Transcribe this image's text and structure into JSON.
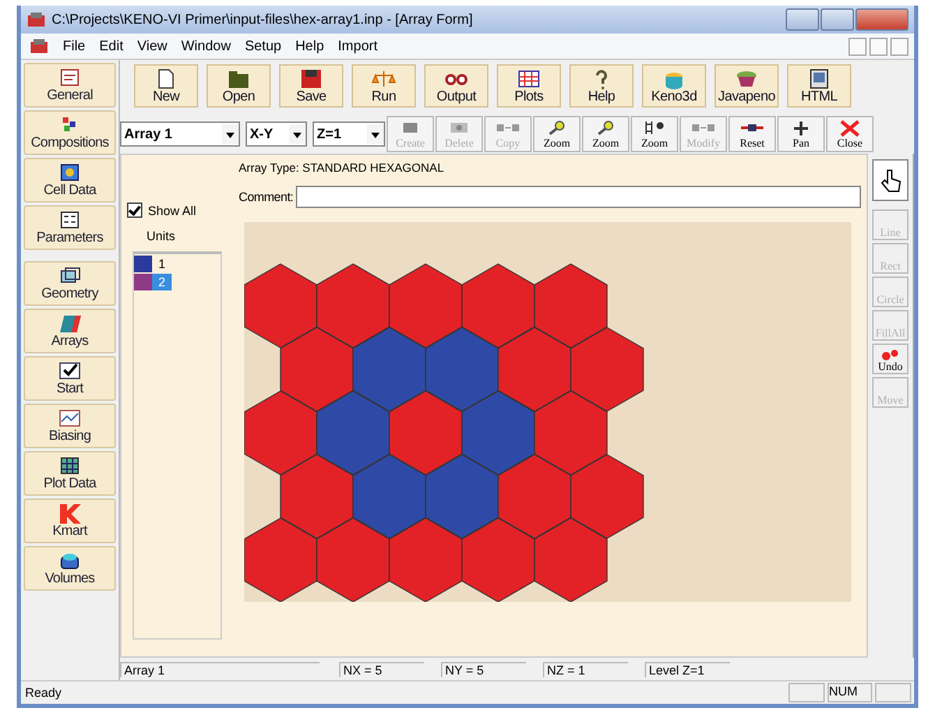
{
  "window": {
    "title": "C:\\Projects\\KENO-VI Primer\\input-files\\hex-array1.inp - [Array Form]"
  },
  "menu": [
    "File",
    "Edit",
    "View",
    "Window",
    "Setup",
    "Help",
    "Import"
  ],
  "toolbar": [
    {
      "label": "New"
    },
    {
      "label": "Open"
    },
    {
      "label": "Save"
    },
    {
      "label": "Run"
    },
    {
      "label": "Output"
    },
    {
      "label": "Plots"
    },
    {
      "label": "Help"
    },
    {
      "label": "Keno3d"
    },
    {
      "label": "Javapeno"
    },
    {
      "label": "HTML"
    }
  ],
  "sidebar": [
    {
      "label": "General"
    },
    {
      "label": "Compositions"
    },
    {
      "label": "Cell Data"
    },
    {
      "label": "Parameters"
    },
    {
      "label": "Geometry"
    },
    {
      "label": "Arrays"
    },
    {
      "label": "Start"
    },
    {
      "label": "Biasing"
    },
    {
      "label": "Plot Data"
    },
    {
      "label": "Kmart"
    },
    {
      "label": "Volumes"
    }
  ],
  "array_toolbar": {
    "dropdowns": [
      "Array 1",
      "X-Y",
      "Z=1"
    ],
    "buttons": [
      {
        "label": "Create",
        "disabled": true
      },
      {
        "label": "Delete",
        "disabled": true
      },
      {
        "label": "Copy",
        "disabled": true
      },
      {
        "label": "Zoom",
        "disabled": false
      },
      {
        "label": "Zoom",
        "disabled": false
      },
      {
        "label": "Zoom",
        "disabled": false
      },
      {
        "label": "Modify",
        "disabled": true
      },
      {
        "label": "Reset",
        "disabled": false
      },
      {
        "label": "Pan",
        "disabled": false
      },
      {
        "label": "Close",
        "disabled": false
      }
    ]
  },
  "array_type": "Array Type: STANDARD HEXAGONAL",
  "show_all": {
    "label": "Show All",
    "checked": true
  },
  "comment": {
    "label": "Comment:"
  },
  "units": {
    "heading": "Units",
    "items": [
      {
        "label": "1",
        "color": "#2b3a9c",
        "selected": false
      },
      {
        "label": "2",
        "color": "#8e3a86",
        "selected": true
      }
    ]
  },
  "array": {
    "rows": [
      [
        {
          "color": "#e32227"
        },
        {
          "color": "#e32227"
        },
        {
          "color": "#e32227"
        },
        {
          "color": "#e32227"
        },
        {
          "color": "#e32227"
        }
      ],
      [
        {
          "color": "#e32227"
        },
        {
          "color": "#2f4aa6"
        },
        {
          "color": "#2f4aa6"
        },
        {
          "color": "#e32227"
        },
        {
          "color": "#e32227"
        }
      ],
      [
        {
          "color": "#e32227"
        },
        {
          "color": "#2f4aa6"
        },
        {
          "color": "#e32227"
        },
        {
          "color": "#2f4aa6"
        },
        {
          "color": "#e32227"
        }
      ],
      [
        {
          "color": "#e32227"
        },
        {
          "color": "#2f4aa6"
        },
        {
          "color": "#2f4aa6"
        },
        {
          "color": "#e32227"
        },
        {
          "color": "#e32227"
        }
      ],
      [
        {
          "color": "#e32227"
        },
        {
          "color": "#e32227"
        },
        {
          "color": "#e32227"
        },
        {
          "color": "#e32227"
        },
        {
          "color": "#e32227"
        }
      ]
    ]
  },
  "tools": [
    {
      "selected": true,
      "disabled": false
    },
    {
      "label": "Line",
      "selected": false,
      "disabled": true
    },
    {
      "label": "Rect",
      "selected": false,
      "disabled": true
    },
    {
      "label": "Circle",
      "selected": false,
      "disabled": true
    },
    {
      "label": "FillAll",
      "selected": false,
      "disabled": true
    },
    {
      "label": "Undo",
      "selected": false,
      "disabled": false
    },
    {
      "label": "Move",
      "selected": false,
      "disabled": true
    }
  ],
  "info_bar": [
    "Array 1",
    "NX = 5",
    "NY =  5",
    "NZ = 1",
    "Level Z=1"
  ],
  "status_bar": {
    "message": "Ready",
    "indicator": "NUM"
  }
}
